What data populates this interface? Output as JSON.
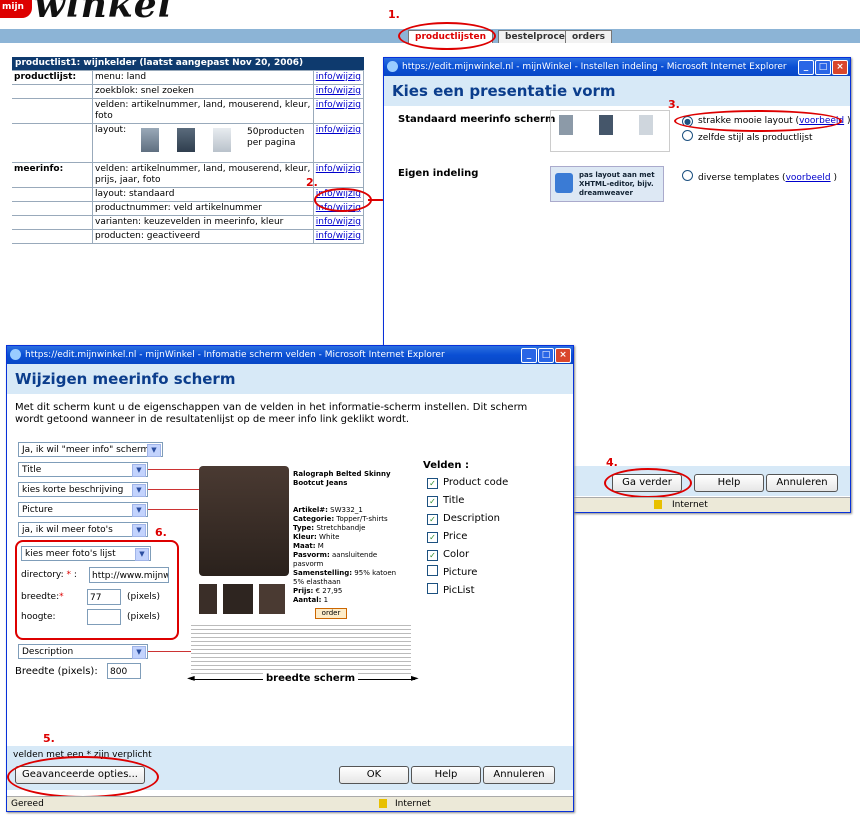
{
  "logo": {
    "badge": "mijn",
    "word": "winkel"
  },
  "tabs": [
    {
      "label": "productlijsten",
      "active": true
    },
    {
      "label": "bestelproces",
      "active": false
    },
    {
      "label": "orders",
      "active": false
    }
  ],
  "step_numbers": [
    "1.",
    "2.",
    "3.",
    "4.",
    "5.",
    "6."
  ],
  "productlist": {
    "header": "productlist1: wijnkelder (laatst aangepast  Nov 20, 2006)",
    "rows": [
      {
        "key": "productlijst:",
        "value": "menu: land",
        "link": "info/wijzig"
      },
      {
        "key": "",
        "value": "zoekblok: snel zoeken",
        "link": "info/wijzig"
      },
      {
        "key": "",
        "value": "velden: artikelnummer, land, mouserend, kleur, foto",
        "link": "info/wijzig"
      },
      {
        "key": "",
        "value": "layout:",
        "extra": "50producten per pagina",
        "link": "info/wijzig"
      },
      {
        "key": "meerinfo:",
        "value": "velden: artikelnummer, land, mouserend, kleur, prijs, jaar, foto",
        "link": "info/wijzig"
      },
      {
        "key": "",
        "value": "layout: standaard",
        "link": "info/wijzig"
      },
      {
        "key": "",
        "value": "productnummer: veld artikelnummer",
        "link": "info/wijzig"
      },
      {
        "key": "",
        "value": "varianten: keuzevelden in meerinfo, kleur",
        "link": "info/wijzig"
      },
      {
        "key": "",
        "value": "producten: geactiveerd",
        "link": "info/wijzig"
      }
    ]
  },
  "window1": {
    "title": "https://edit.mijnwinkel.nl - mijnWinkel - Instellen indeling - Microsoft Internet Explorer",
    "heading": "Kies een presentatie vorm",
    "section1_label": "Standaard meerinfo scherm",
    "radio1_text": "strakke mooie layout (",
    "radio1_link": "voorbeeld",
    "radio1_close": " )",
    "radio2_text": "zelfde stijl als productlijst",
    "section2_label": "Eigen indeling",
    "dw_box_text": "pas layout aan met XHTML-editor, bijv. dreamweaver",
    "radio3_text": "diverse templates (",
    "radio3_link": "voorbeeld",
    "radio3_close": " )",
    "buttons": {
      "next": "Ga verder",
      "help": "Help",
      "cancel": "Annuleren"
    },
    "status": "Internet"
  },
  "window2": {
    "title": "https://edit.mijnwinkel.nl - mijnWinkel - Infomatie scherm velden - Microsoft Internet Explorer",
    "heading": "Wijzigen meerinfo scherm",
    "intro": "Met dit scherm kunt u de eigenschappen van de velden in het informatie-scherm instellen. Dit scherm wordt getoond wanneer in de resultatenlijst op de meer info link geklikt wordt.",
    "selects": {
      "show": "Ja, ik wil \"meer info\" schermen",
      "title": "Title",
      "short_desc": "kies korte beschrijving",
      "picture": "Picture",
      "more_photos": "ja, ik wil meer foto's",
      "photo_list": "kies meer foto's lijst",
      "description": "Description"
    },
    "directory_label": "directory:",
    "required_mark": "*",
    "directory_value": "http://www.mijnwink",
    "breedte_label": "breedte:",
    "breedte_value": "77",
    "hoogte_label": "hoogte:",
    "hoogte_value": "",
    "pixels": "(pixels)",
    "screen_width_label": "Breedte (pixels):",
    "screen_width_value": "800",
    "width_arrow_label": "breedte scherm",
    "fields_title": "Velden :",
    "fields": [
      {
        "label": "Product code",
        "checked": true
      },
      {
        "label": "Title",
        "checked": true
      },
      {
        "label": "Description",
        "checked": true
      },
      {
        "label": "Price",
        "checked": true
      },
      {
        "label": "Color",
        "checked": true
      },
      {
        "label": "Picture",
        "checked": false
      },
      {
        "label": "PicList",
        "checked": false
      }
    ],
    "preview": {
      "title": "Ralograph Belted Skinny Bootcut Jeans",
      "specs": [
        {
          "k": "Artikel#:",
          "v": "SW332_1"
        },
        {
          "k": "Categorie:",
          "v": "Topper/T-shirts"
        },
        {
          "k": "Type:",
          "v": "Stretchbandje"
        },
        {
          "k": "Kleur:",
          "v": "White"
        },
        {
          "k": "Maat:",
          "v": "M"
        },
        {
          "k": "Pasvorm:",
          "v": "aansluitende pasvorm"
        },
        {
          "k": "Samenstelling:",
          "v": "95% katoen 5% elasthaan"
        },
        {
          "k": "Prijs:",
          "v": "€ 27,95"
        },
        {
          "k": "Aantal:",
          "v": "1"
        }
      ],
      "order_button": "order"
    },
    "required_note": "velden met een * zijn verplicht",
    "buttons": {
      "advanced": "Geavanceerde opties...",
      "ok": "OK",
      "help": "Help",
      "cancel": "Annuleren"
    },
    "status_left": "Gereed",
    "status_right": "Internet"
  }
}
